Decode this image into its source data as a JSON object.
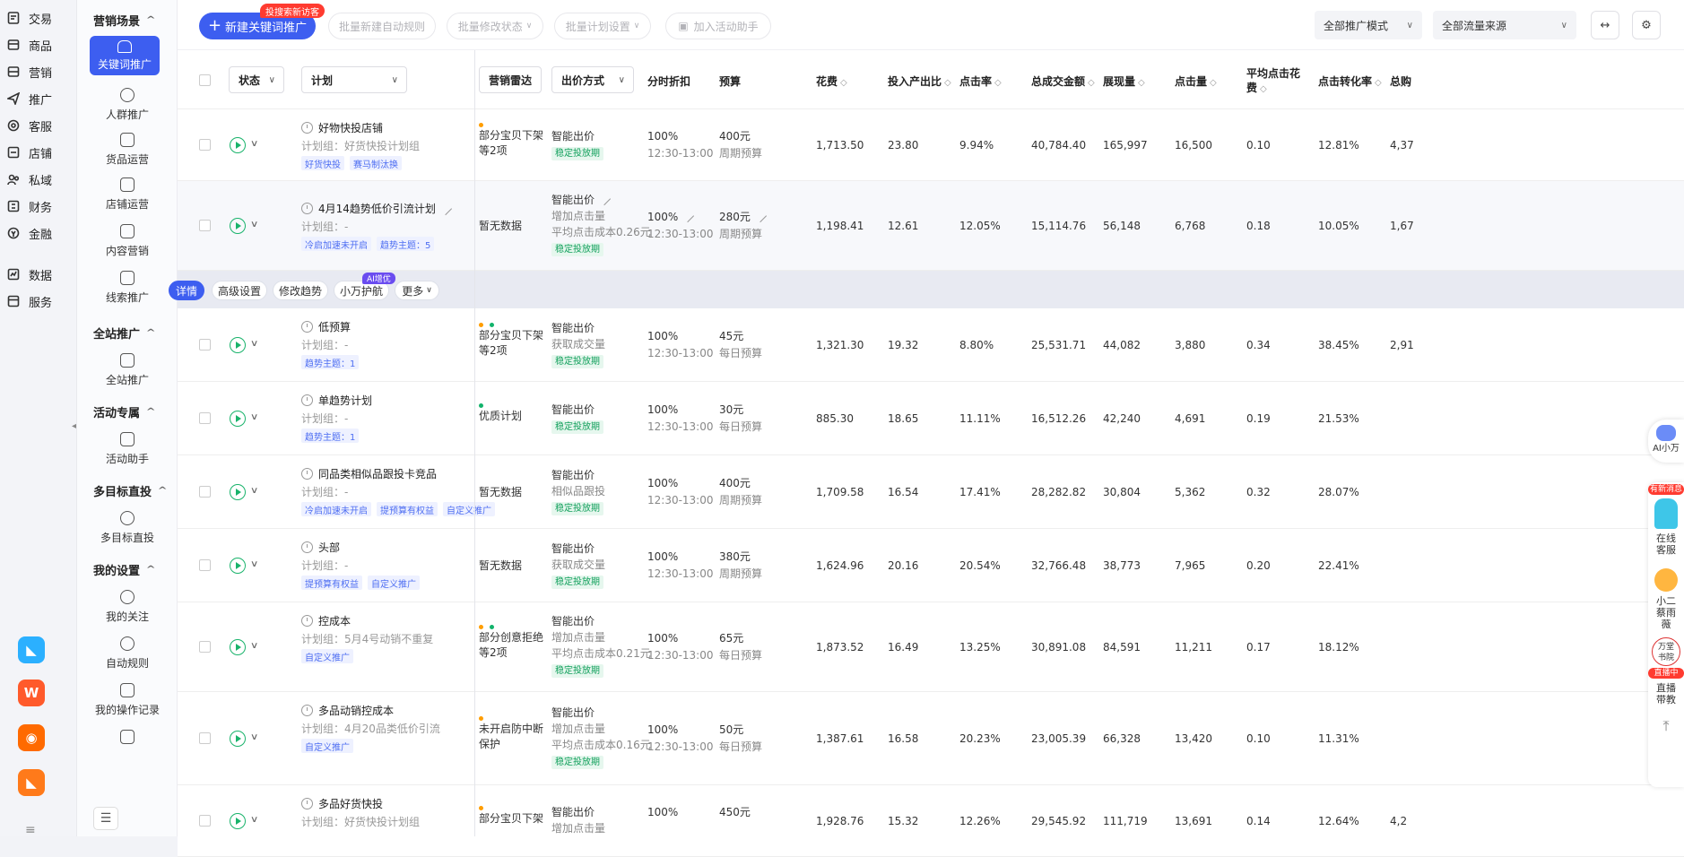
{
  "left_nav": {
    "items": [
      {
        "label": "交易",
        "icon": "orders-icon"
      },
      {
        "label": "商品",
        "icon": "goods-icon"
      },
      {
        "label": "营销",
        "icon": "marketing-icon"
      },
      {
        "label": "推广",
        "icon": "promotion-icon"
      },
      {
        "label": "客服",
        "icon": "service-icon"
      },
      {
        "label": "店铺",
        "icon": "store-icon"
      },
      {
        "label": "私域",
        "icon": "private-domain-icon"
      },
      {
        "label": "财务",
        "icon": "finance-icon"
      },
      {
        "label": "金融",
        "icon": "banking-icon"
      },
      {
        "label": "数据",
        "icon": "data-icon"
      },
      {
        "label": "服务",
        "icon": "services-icon"
      }
    ],
    "apps": [
      {
        "name": "app-icon-1",
        "color": "#2bb0ff"
      },
      {
        "name": "app-icon-2",
        "color": "#ff5a2b"
      },
      {
        "name": "app-icon-3",
        "color": "#ff6a00"
      },
      {
        "name": "app-icon-4",
        "color": "#ff7a1a"
      }
    ],
    "bottom_glyph": "≡"
  },
  "sub_nav": {
    "groups": [
      {
        "title": "营销场景",
        "items": [
          "关键词推广",
          "人群推广",
          "货品运营",
          "店铺运营",
          "内容营销",
          "线索推广"
        ]
      },
      {
        "title": "全站推广",
        "items": [
          "全站推广"
        ]
      },
      {
        "title": "活动专属",
        "items": [
          "活动助手"
        ]
      },
      {
        "title": "多目标直投",
        "items": [
          "多目标直投"
        ]
      },
      {
        "title": "我的设置",
        "items": [
          "我的关注",
          "自动规则",
          "我的操作记录"
        ]
      }
    ],
    "active": "关键词推广",
    "collapse_glyph": "☰"
  },
  "toolbar": {
    "new_label": "新建关键词推广",
    "new_badge": "投搜索新访客",
    "bulk_rule": "批量新建自动规则",
    "bulk_status": "批量修改状态",
    "bulk_plan": "批量计划设置",
    "add_helper": "加入活动助手",
    "mode_select": "全部推广模式",
    "traffic_select": "全部流量来源"
  },
  "columns": {
    "status": "状态",
    "plan": "计划",
    "radar": "营销雷达",
    "bid_method": "出价方式",
    "time_discount": "分时折扣",
    "budget": "预算",
    "cost": "花费",
    "roi": "投入产出比",
    "ctr": "点击率",
    "gmv": "总成交金额",
    "impressions": "展现量",
    "clicks": "点击量",
    "cpc": "平均点击花费",
    "cvr": "点击转化率",
    "total": "总购"
  },
  "action_bar": {
    "detail": "详情",
    "advanced": "高级设置",
    "modify_trend": "修改趋势",
    "autopilot": "小万护航",
    "ai_badge": "AI增优",
    "more": "更多"
  },
  "rows": [
    {
      "name": "好物快投店铺",
      "group": "计划组：好货快投计划组",
      "tags": [
        "好货快投",
        "赛马制汰换"
      ],
      "dots": [
        "#ff9d00"
      ],
      "radar": [
        "部分宝贝下架",
        "等2项"
      ],
      "bid": "智能出价",
      "bid_sub": [],
      "bid_tag": "稳定投放期",
      "discount": "100%",
      "time": "12:30-13:00",
      "budget": "400元",
      "budget_type": "周期预算",
      "cost": "1,713.50",
      "roi": "23.80",
      "ctr": "9.94%",
      "gmv": "40,784.40",
      "impressions": "165,997",
      "clicks": "16,500",
      "cpc": "0.10",
      "cvr": "12.81%",
      "total": "4,37"
    },
    {
      "name": "4月14趋势低价引流计划",
      "group": "计划组：-",
      "tags": [
        "冷启加速未开启",
        "趋势主题：5"
      ],
      "dots": [],
      "radar": [
        "暂无数据"
      ],
      "bid": "智能出价",
      "bid_sub": [
        "增加点击量",
        "平均点击成本0.26元"
      ],
      "bid_tag": "稳定投放期",
      "discount": "100%",
      "time": "12:30-13:00",
      "budget": "280元",
      "budget_type": "周期预算",
      "cost": "1,198.41",
      "roi": "12.61",
      "ctr": "12.05%",
      "gmv": "15,114.76",
      "impressions": "56,148",
      "clicks": "6,768",
      "cpc": "0.18",
      "cvr": "10.05%",
      "total": "1,67"
    },
    {
      "name": "低预算",
      "group": "计划组：-",
      "tags": [
        "趋势主题：1"
      ],
      "dots": [
        "#ff9d00",
        "#12b36b"
      ],
      "radar": [
        "部分宝贝下架",
        "等2项"
      ],
      "bid": "智能出价",
      "bid_sub": [
        "获取成交量"
      ],
      "bid_tag": "稳定投放期",
      "discount": "100%",
      "time": "12:30-13:00",
      "budget": "45元",
      "budget_type": "每日预算",
      "cost": "1,321.30",
      "roi": "19.32",
      "ctr": "8.80%",
      "gmv": "25,531.71",
      "impressions": "44,082",
      "clicks": "3,880",
      "cpc": "0.34",
      "cvr": "38.45%",
      "total": "2,91"
    },
    {
      "name": "单趋势计划",
      "group": "计划组：-",
      "tags": [
        "趋势主题：1"
      ],
      "dots": [
        "#12b36b"
      ],
      "radar": [
        "优质计划"
      ],
      "bid": "智能出价",
      "bid_sub": [],
      "bid_tag": "稳定投放期",
      "discount": "100%",
      "time": "12:30-13:00",
      "budget": "30元",
      "budget_type": "每日预算",
      "cost": "885.30",
      "roi": "18.65",
      "ctr": "11.11%",
      "gmv": "16,512.26",
      "impressions": "42,240",
      "clicks": "4,691",
      "cpc": "0.19",
      "cvr": "21.53%",
      "total": ""
    },
    {
      "name": "同品类相似品跟投卡竞品",
      "group": "计划组：-",
      "tags": [
        "冷启加速未开启",
        "提预算有权益",
        "自定义推广"
      ],
      "dots": [],
      "radar": [
        "暂无数据"
      ],
      "bid": "智能出价",
      "bid_sub": [
        "相似品跟投"
      ],
      "bid_tag": "稳定投放期",
      "discount": "100%",
      "time": "12:30-13:00",
      "budget": "400元",
      "budget_type": "周期预算",
      "cost": "1,709.58",
      "roi": "16.54",
      "ctr": "17.41%",
      "gmv": "28,282.82",
      "impressions": "30,804",
      "clicks": "5,362",
      "cpc": "0.32",
      "cvr": "28.07%",
      "total": ""
    },
    {
      "name": "头部",
      "group": "计划组：-",
      "tags": [
        "提预算有权益",
        "自定义推广"
      ],
      "dots": [],
      "radar": [
        "暂无数据"
      ],
      "bid": "智能出价",
      "bid_sub": [
        "获取成交量"
      ],
      "bid_tag": "稳定投放期",
      "discount": "100%",
      "time": "12:30-13:00",
      "budget": "380元",
      "budget_type": "周期预算",
      "cost": "1,624.96",
      "roi": "20.16",
      "ctr": "20.54%",
      "gmv": "32,766.48",
      "impressions": "38,773",
      "clicks": "7,965",
      "cpc": "0.20",
      "cvr": "22.41%",
      "total": ""
    },
    {
      "name": "控成本",
      "group": "计划组：5月4号动销不重复",
      "tags": [
        "自定义推广"
      ],
      "dots": [
        "#ff9d00",
        "#12b36b"
      ],
      "radar": [
        "部分创意拒绝",
        "等2项"
      ],
      "bid": "智能出价",
      "bid_sub": [
        "增加点击量",
        "平均点击成本0.21元"
      ],
      "bid_tag": "稳定投放期",
      "discount": "100%",
      "time": "12:30-13:00",
      "budget": "65元",
      "budget_type": "每日预算",
      "cost": "1,873.52",
      "roi": "16.49",
      "ctr": "13.25%",
      "gmv": "30,891.08",
      "impressions": "84,591",
      "clicks": "11,211",
      "cpc": "0.17",
      "cvr": "18.12%",
      "total": ""
    },
    {
      "name": "多品动销控成本",
      "group": "计划组：4月20品类低价引流",
      "tags": [
        "自定义推广"
      ],
      "dots": [
        "#ff9d00"
      ],
      "radar": [
        "未开启防中断",
        "保护"
      ],
      "bid": "智能出价",
      "bid_sub": [
        "增加点击量",
        "平均点击成本0.16元"
      ],
      "bid_tag": "稳定投放期",
      "discount": "100%",
      "time": "12:30-13:00",
      "budget": "50元",
      "budget_type": "每日预算",
      "cost": "1,387.61",
      "roi": "16.58",
      "ctr": "20.23%",
      "gmv": "23,005.39",
      "impressions": "66,328",
      "clicks": "13,420",
      "cpc": "0.10",
      "cvr": "11.31%",
      "total": ""
    },
    {
      "name": "多品好货快投",
      "group": "计划组：好货快投计划组",
      "tags": [],
      "dots": [
        "#ff9d00"
      ],
      "radar": [
        "部分宝贝下架"
      ],
      "bid": "智能出价",
      "bid_sub": [
        "增加点击量"
      ],
      "bid_tag": "",
      "discount": "100%",
      "time": "",
      "budget": "450元",
      "budget_type": "",
      "cost": "1,928.76",
      "roi": "15.32",
      "ctr": "12.26%",
      "gmv": "29,545.92",
      "impressions": "111,719",
      "clicks": "13,691",
      "cpc": "0.14",
      "cvr": "12.64%",
      "total": "4,2"
    }
  ],
  "float_panel": {
    "ai_label": "AI小万",
    "new_msg": "有新消息",
    "online_service": [
      "在线",
      "客服"
    ],
    "assistant": [
      "小二",
      "蔡雨",
      "薇"
    ],
    "academy": [
      "万堂",
      "书院"
    ],
    "live_badge": "直播中",
    "live_teach": [
      "直播",
      "带教"
    ],
    "top_glyph": "⤒"
  }
}
